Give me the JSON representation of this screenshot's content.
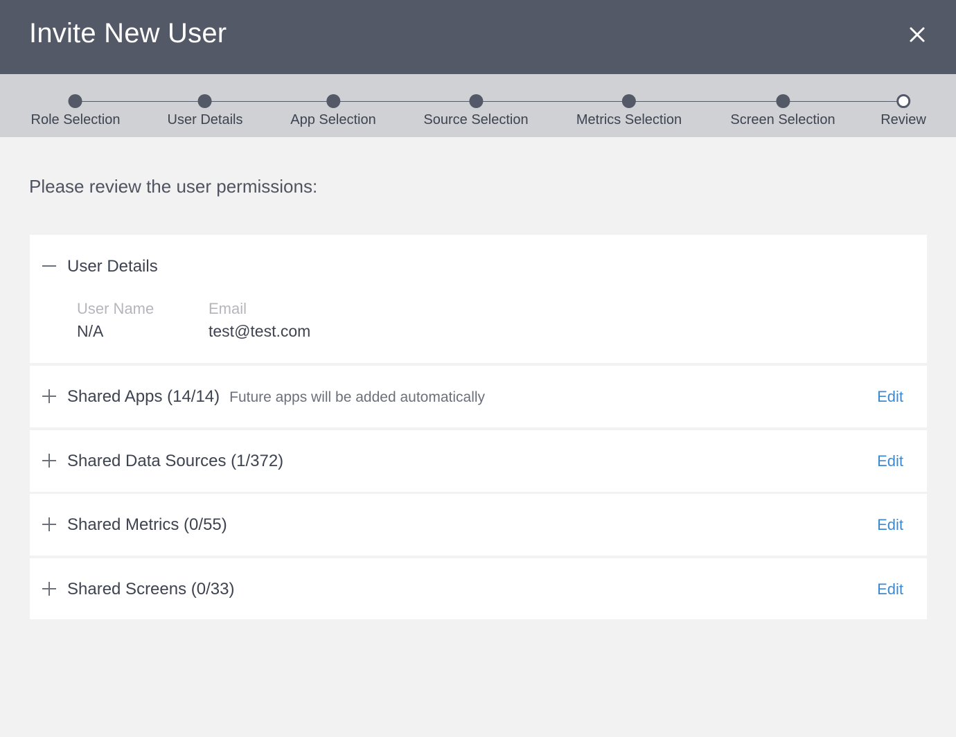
{
  "dialog": {
    "title": "Invite New User",
    "close_icon": "close-icon"
  },
  "stepper": {
    "steps": [
      {
        "label": "Role Selection",
        "state": "completed"
      },
      {
        "label": "User Details",
        "state": "completed"
      },
      {
        "label": "App Selection",
        "state": "completed"
      },
      {
        "label": "Source Selection",
        "state": "completed"
      },
      {
        "label": "Metrics Selection",
        "state": "completed"
      },
      {
        "label": "Screen Selection",
        "state": "completed"
      },
      {
        "label": "Review",
        "state": "current"
      }
    ]
  },
  "prompt": "Please review the user permissions:",
  "sections": {
    "user_details": {
      "title": "User Details",
      "expanded": true,
      "toggle_icon": "minus-icon",
      "fields": [
        {
          "label": "User Name",
          "value": "N/A"
        },
        {
          "label": "Email",
          "value": "test@test.com"
        }
      ]
    },
    "shared_apps": {
      "title": "Shared Apps (14/14)",
      "note": "Future apps will be added automatically",
      "edit_label": "Edit",
      "toggle_icon": "plus-icon"
    },
    "shared_data_sources": {
      "title": "Shared Data Sources (1/372)",
      "edit_label": "Edit",
      "toggle_icon": "plus-icon"
    },
    "shared_metrics": {
      "title": "Shared Metrics (0/55)",
      "edit_label": "Edit",
      "toggle_icon": "plus-icon"
    },
    "shared_screens": {
      "title": "Shared Screens (0/33)",
      "edit_label": "Edit",
      "toggle_icon": "plus-icon"
    }
  },
  "colors": {
    "header_bg": "#545967",
    "stepper_bg": "#d0d1d4",
    "page_bg": "#f2f2f3",
    "link": "#3b8ad1"
  }
}
